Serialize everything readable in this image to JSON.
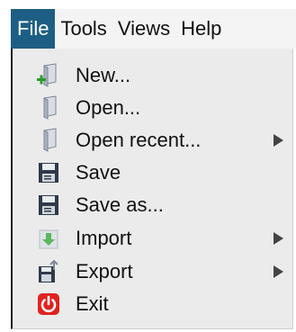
{
  "menubar": {
    "items": [
      {
        "label": "File",
        "active": true
      },
      {
        "label": "Tools"
      },
      {
        "label": "Views"
      },
      {
        "label": "Help"
      }
    ]
  },
  "file_menu": {
    "items": [
      {
        "label": "New...",
        "icon": "new-document-icon",
        "submenu": false
      },
      {
        "label": "Open...",
        "icon": "open-document-icon",
        "submenu": false
      },
      {
        "label": "Open recent...",
        "icon": "open-recent-icon",
        "submenu": true
      },
      {
        "label": "Save",
        "icon": "floppy-disk-icon",
        "submenu": false
      },
      {
        "label": "Save as...",
        "icon": "floppy-disk-icon",
        "submenu": false
      },
      {
        "label": "Import",
        "icon": "import-icon",
        "submenu": true
      },
      {
        "label": "Export",
        "icon": "export-icon",
        "submenu": true
      },
      {
        "label": "Exit",
        "icon": "power-icon",
        "submenu": false
      }
    ]
  },
  "colors": {
    "menubar_active_bg": "#1d5f84",
    "menu_bg": "#ebebeb",
    "exit_icon": "#e0221f"
  }
}
